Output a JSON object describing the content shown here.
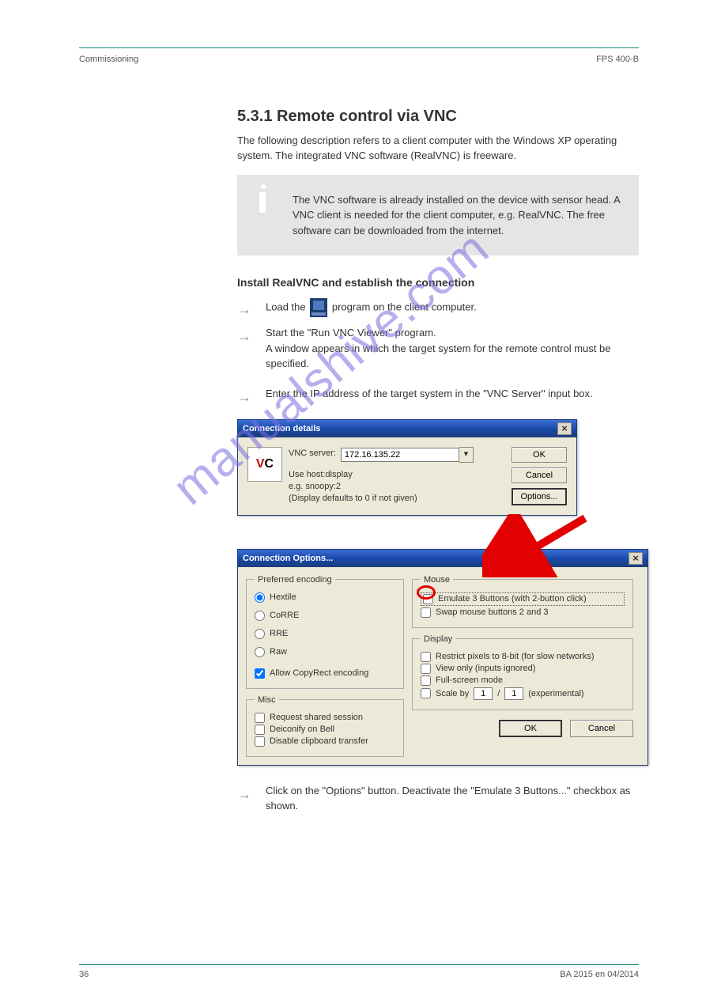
{
  "header": {
    "left": "Commissioning",
    "right": "FPS 400-B"
  },
  "section_title": "5.3.1 Remote control via VNC",
  "intro_para": "The following description refers to a client computer with the Windows XP operating system. The integrated VNC software (RealVNC) is freeware.",
  "info_text": "The VNC software is already installed on the device with sensor head. A VNC client is needed for the client computer, e.g. RealVNC. The free software can be downloaded from the internet.",
  "sub_title": "Install RealVNC and establish the connection",
  "step1_prefix": "Load the",
  "step1_suffix": "program on the client computer.",
  "step2": "Start the \"Run VNC Viewer\" program.",
  "step2_detail": "A window appears in which the target system for the remote control must be specified.",
  "step3": "Enter the IP address of the target system in the \"VNC Server\" input box.",
  "dlg1": {
    "title": "Connection details",
    "server_label": "VNC server:",
    "server_value": "172.16.135.22",
    "hint1": "Use host:display",
    "hint2": "e.g. snoopy:2",
    "hint3": "(Display defaults to 0 if not given)",
    "ok": "OK",
    "cancel": "Cancel",
    "options": "Options..."
  },
  "dlg2": {
    "title": "Connection Options...",
    "encoding_legend": "Preferred encoding",
    "enc_hextile": "Hextile",
    "enc_corre": "CoRRE",
    "enc_rre": "RRE",
    "enc_raw": "Raw",
    "allow_copyrect": "Allow CopyRect encoding",
    "mouse_legend": "Mouse",
    "emulate3": "Emulate 3 Buttons (with 2-button click)",
    "swap": "Swap mouse buttons 2 and 3",
    "display_legend": "Display",
    "restrict8": "Restrict pixels to 8-bit (for slow networks)",
    "viewonly": "View only (inputs ignored)",
    "fullscreen": "Full-screen mode",
    "scaleby": "Scale by",
    "scale1": "1",
    "scale2": "1",
    "experimental": "(experimental)",
    "misc_legend": "Misc",
    "shared": "Request shared session",
    "deiconify": "Deiconify on Bell",
    "disable_clip": "Disable clipboard transfer",
    "ok": "OK",
    "cancel": "Cancel"
  },
  "step4": "Click on the \"Options\" button. Deactivate the \"Emulate 3 Buttons...\" checkbox as shown.",
  "footer": {
    "left": "36",
    "right": "BA 2015 en 04/2014"
  },
  "watermark": "manualshive.com"
}
